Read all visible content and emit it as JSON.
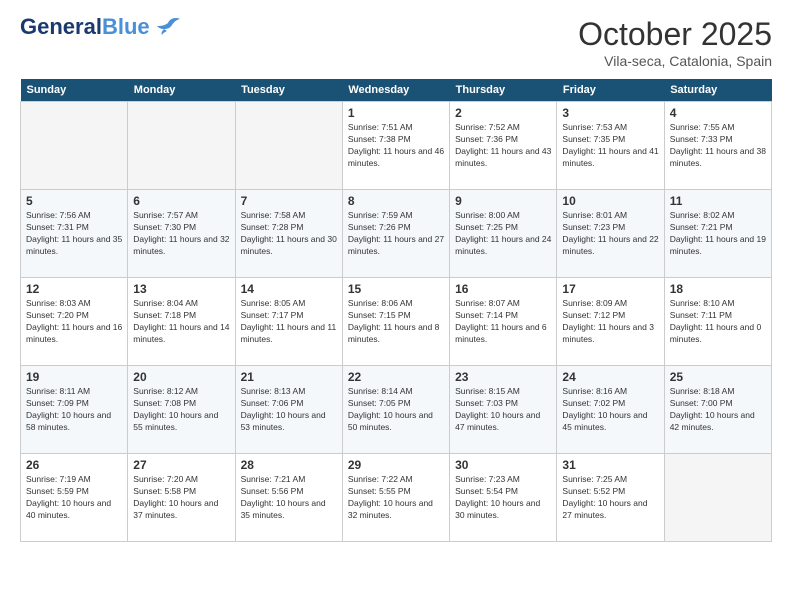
{
  "header": {
    "logo_line1": "General",
    "logo_line2": "Blue",
    "month": "October 2025",
    "location": "Vila-seca, Catalonia, Spain"
  },
  "weekdays": [
    "Sunday",
    "Monday",
    "Tuesday",
    "Wednesday",
    "Thursday",
    "Friday",
    "Saturday"
  ],
  "weeks": [
    [
      {
        "day": "",
        "empty": true
      },
      {
        "day": "",
        "empty": true
      },
      {
        "day": "",
        "empty": true
      },
      {
        "day": "1",
        "sunrise": "7:51 AM",
        "sunset": "7:38 PM",
        "daylight": "11 hours and 46 minutes."
      },
      {
        "day": "2",
        "sunrise": "7:52 AM",
        "sunset": "7:36 PM",
        "daylight": "11 hours and 43 minutes."
      },
      {
        "day": "3",
        "sunrise": "7:53 AM",
        "sunset": "7:35 PM",
        "daylight": "11 hours and 41 minutes."
      },
      {
        "day": "4",
        "sunrise": "7:55 AM",
        "sunset": "7:33 PM",
        "daylight": "11 hours and 38 minutes."
      }
    ],
    [
      {
        "day": "5",
        "sunrise": "7:56 AM",
        "sunset": "7:31 PM",
        "daylight": "11 hours and 35 minutes."
      },
      {
        "day": "6",
        "sunrise": "7:57 AM",
        "sunset": "7:30 PM",
        "daylight": "11 hours and 32 minutes."
      },
      {
        "day": "7",
        "sunrise": "7:58 AM",
        "sunset": "7:28 PM",
        "daylight": "11 hours and 30 minutes."
      },
      {
        "day": "8",
        "sunrise": "7:59 AM",
        "sunset": "7:26 PM",
        "daylight": "11 hours and 27 minutes."
      },
      {
        "day": "9",
        "sunrise": "8:00 AM",
        "sunset": "7:25 PM",
        "daylight": "11 hours and 24 minutes."
      },
      {
        "day": "10",
        "sunrise": "8:01 AM",
        "sunset": "7:23 PM",
        "daylight": "11 hours and 22 minutes."
      },
      {
        "day": "11",
        "sunrise": "8:02 AM",
        "sunset": "7:21 PM",
        "daylight": "11 hours and 19 minutes."
      }
    ],
    [
      {
        "day": "12",
        "sunrise": "8:03 AM",
        "sunset": "7:20 PM",
        "daylight": "11 hours and 16 minutes."
      },
      {
        "day": "13",
        "sunrise": "8:04 AM",
        "sunset": "7:18 PM",
        "daylight": "11 hours and 14 minutes."
      },
      {
        "day": "14",
        "sunrise": "8:05 AM",
        "sunset": "7:17 PM",
        "daylight": "11 hours and 11 minutes."
      },
      {
        "day": "15",
        "sunrise": "8:06 AM",
        "sunset": "7:15 PM",
        "daylight": "11 hours and 8 minutes."
      },
      {
        "day": "16",
        "sunrise": "8:07 AM",
        "sunset": "7:14 PM",
        "daylight": "11 hours and 6 minutes."
      },
      {
        "day": "17",
        "sunrise": "8:09 AM",
        "sunset": "7:12 PM",
        "daylight": "11 hours and 3 minutes."
      },
      {
        "day": "18",
        "sunrise": "8:10 AM",
        "sunset": "7:11 PM",
        "daylight": "11 hours and 0 minutes."
      }
    ],
    [
      {
        "day": "19",
        "sunrise": "8:11 AM",
        "sunset": "7:09 PM",
        "daylight": "10 hours and 58 minutes."
      },
      {
        "day": "20",
        "sunrise": "8:12 AM",
        "sunset": "7:08 PM",
        "daylight": "10 hours and 55 minutes."
      },
      {
        "day": "21",
        "sunrise": "8:13 AM",
        "sunset": "7:06 PM",
        "daylight": "10 hours and 53 minutes."
      },
      {
        "day": "22",
        "sunrise": "8:14 AM",
        "sunset": "7:05 PM",
        "daylight": "10 hours and 50 minutes."
      },
      {
        "day": "23",
        "sunrise": "8:15 AM",
        "sunset": "7:03 PM",
        "daylight": "10 hours and 47 minutes."
      },
      {
        "day": "24",
        "sunrise": "8:16 AM",
        "sunset": "7:02 PM",
        "daylight": "10 hours and 45 minutes."
      },
      {
        "day": "25",
        "sunrise": "8:18 AM",
        "sunset": "7:00 PM",
        "daylight": "10 hours and 42 minutes."
      }
    ],
    [
      {
        "day": "26",
        "sunrise": "7:19 AM",
        "sunset": "5:59 PM",
        "daylight": "10 hours and 40 minutes."
      },
      {
        "day": "27",
        "sunrise": "7:20 AM",
        "sunset": "5:58 PM",
        "daylight": "10 hours and 37 minutes."
      },
      {
        "day": "28",
        "sunrise": "7:21 AM",
        "sunset": "5:56 PM",
        "daylight": "10 hours and 35 minutes."
      },
      {
        "day": "29",
        "sunrise": "7:22 AM",
        "sunset": "5:55 PM",
        "daylight": "10 hours and 32 minutes."
      },
      {
        "day": "30",
        "sunrise": "7:23 AM",
        "sunset": "5:54 PM",
        "daylight": "10 hours and 30 minutes."
      },
      {
        "day": "31",
        "sunrise": "7:25 AM",
        "sunset": "5:52 PM",
        "daylight": "10 hours and 27 minutes."
      },
      {
        "day": "",
        "empty": true
      }
    ]
  ]
}
